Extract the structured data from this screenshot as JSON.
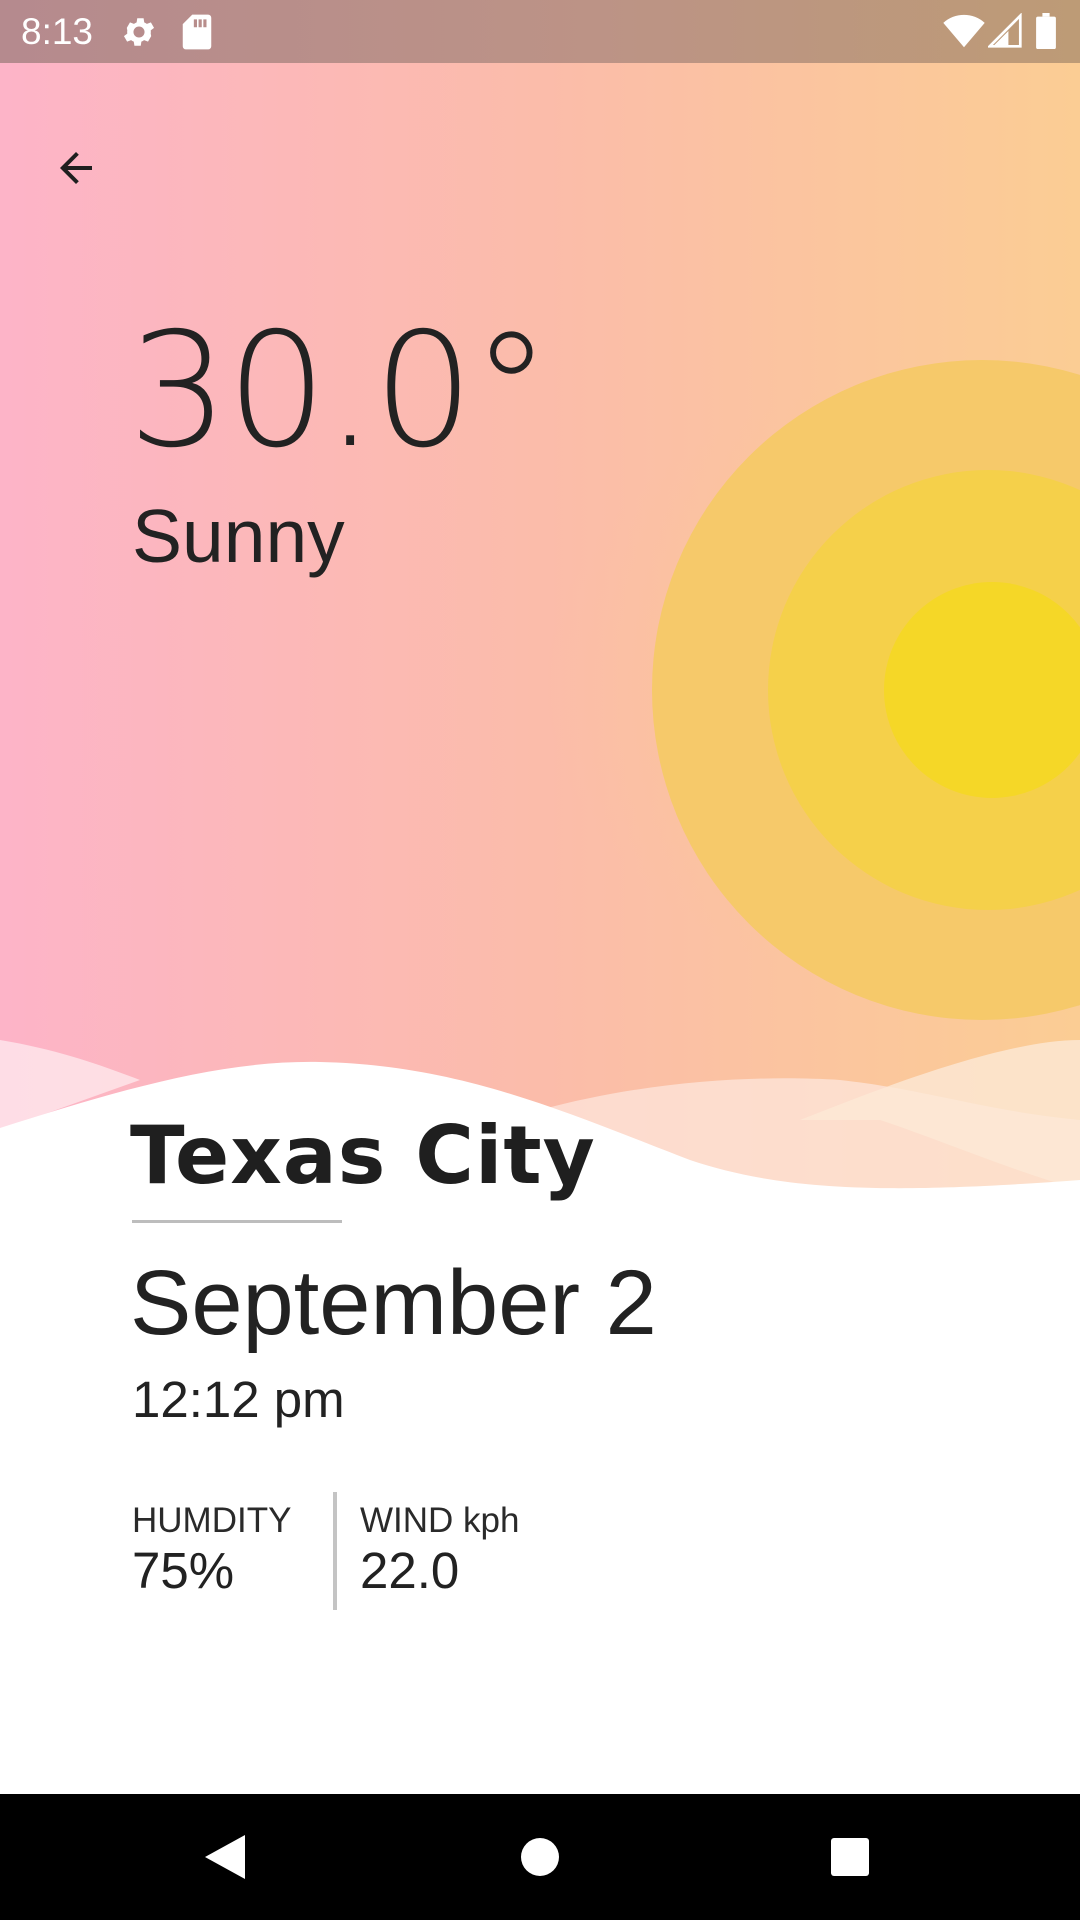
{
  "status_bar": {
    "time": "8:13",
    "icons": [
      "settings-icon",
      "sd-card-icon",
      "wifi-icon",
      "signal-icon",
      "battery-icon"
    ]
  },
  "header": {
    "back_icon": "arrow-back-icon"
  },
  "weather": {
    "temperature": "30.0°",
    "condition": "Sunny"
  },
  "location": {
    "city": "Texas City",
    "date": "September 2",
    "time": "12:12 pm"
  },
  "stats": {
    "humidity_label": "HUMDITY",
    "humidity_value": "75%",
    "wind_label": "WIND kph",
    "wind_value": "22.0"
  },
  "navigation": {
    "buttons": [
      "nav-back-icon",
      "nav-home-icon",
      "nav-recents-icon"
    ]
  },
  "colors": {
    "sky_left": "#fdb4c8",
    "sky_right": "#fbcd94",
    "sun_outer": "#f6c96a",
    "sun_middle": "#f5d04a",
    "sun_inner": "#f5d727",
    "status_bar": "#b58a8e",
    "nav_bar": "#000000"
  }
}
